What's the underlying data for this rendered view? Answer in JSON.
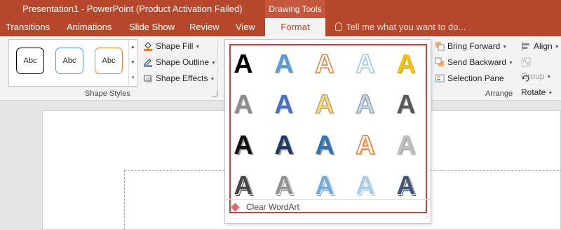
{
  "window": {
    "title": "Presentation1 - PowerPoint (Product Activation Failed)",
    "context_tab_group": "Drawing Tools"
  },
  "tabs": [
    {
      "label": "Transitions",
      "active": false
    },
    {
      "label": "Animations",
      "active": false
    },
    {
      "label": "Slide Show",
      "active": false
    },
    {
      "label": "Review",
      "active": false
    },
    {
      "label": "View",
      "active": false
    },
    {
      "label": "Format",
      "active": true
    }
  ],
  "tell_me": {
    "placeholder": "Tell me what you want to do..."
  },
  "ribbon": {
    "shape_styles": {
      "swatches": [
        {
          "label": "Abc",
          "border_color": "#000000"
        },
        {
          "label": "Abc",
          "border_color": "#5b9bd5"
        },
        {
          "label": "Abc",
          "border_color": "#ed7d31"
        }
      ],
      "shape_fill": "Shape Fill",
      "shape_outline": "Shape Outline",
      "shape_effects": "Shape Effects",
      "group_label": "Shape Styles"
    },
    "arrange": {
      "bring_forward": "Bring Forward",
      "send_backward": "Send Backward",
      "selection_pane": "Selection Pane",
      "align": "Align",
      "group": "Group",
      "rotate": "Rotate",
      "group_label": "Arrange"
    }
  },
  "wordart_gallery": {
    "letter": "A",
    "clear_label": "Clear WordArt",
    "highlight_color": "#d93b3b",
    "styles": [
      {
        "name": "black-solid",
        "color": "#000000"
      },
      {
        "name": "blue-gradient",
        "color": "#5b9bd5"
      },
      {
        "name": "orange-outline",
        "color": "#ed7d31"
      },
      {
        "name": "light-blue-outline",
        "color": "#9dc3e6"
      },
      {
        "name": "gold-bevel",
        "color": "#f2c314"
      },
      {
        "name": "gray-solid",
        "color": "#8c8c8c"
      },
      {
        "name": "blue-reflection",
        "color": "#4472c4"
      },
      {
        "name": "yellow-outline",
        "color": "#ffd966"
      },
      {
        "name": "pale-blue-outline",
        "color": "#bdd7ee"
      },
      {
        "name": "dark-gray-bevel",
        "color": "#595959"
      },
      {
        "name": "black-shadow",
        "color": "#111111"
      },
      {
        "name": "navy-shadow",
        "color": "#1f3864"
      },
      {
        "name": "blue-shadow",
        "color": "#2e75b6"
      },
      {
        "name": "orange-white-outline",
        "color": "#ed7d31"
      },
      {
        "name": "silver-gradient",
        "color": "#bfbfbf"
      },
      {
        "name": "black-pattern",
        "color": "#262626"
      },
      {
        "name": "gray-pattern",
        "color": "#7f7f7f"
      },
      {
        "name": "blue-pattern",
        "color": "#5b9bd5"
      },
      {
        "name": "light-blue-pattern",
        "color": "#9dc3e6"
      },
      {
        "name": "navy-pattern",
        "color": "#203864"
      }
    ]
  }
}
